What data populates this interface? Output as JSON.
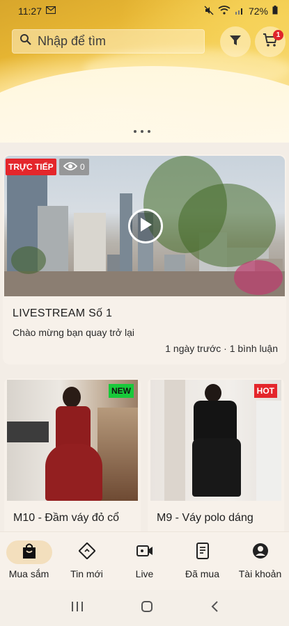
{
  "status_bar": {
    "time": "11:27",
    "battery": "72%"
  },
  "search": {
    "placeholder": "Nhập để tìm"
  },
  "cart": {
    "badge_count": "1"
  },
  "livestream": {
    "live_label": "TRỰC TIẾP",
    "viewers": "0",
    "title": "LIVESTREAM Số 1",
    "subtitle": "Chào mừng bạn quay trở lại",
    "meta": "1 ngày trước · 1 bình luận"
  },
  "products": [
    {
      "name": "M10 - Đầm váy đỏ cổ",
      "badge": "NEW",
      "badge_color": "#18c93a"
    },
    {
      "name": "M9 - Váy polo dáng",
      "badge": "HOT",
      "badge_color": "#e4262b"
    }
  ],
  "bottom_nav": [
    {
      "label": "Mua sắm",
      "icon": "shopping-bag-icon",
      "active": true
    },
    {
      "label": "Tin mới",
      "icon": "news-tag-icon",
      "active": false
    },
    {
      "label": "Live",
      "icon": "video-camera-icon",
      "active": false
    },
    {
      "label": "Đã mua",
      "icon": "receipt-icon",
      "active": false
    },
    {
      "label": "Tài khoản",
      "icon": "account-icon",
      "active": false
    }
  ],
  "colors": {
    "accent": "#f3dfbd",
    "live_red": "#e4262b",
    "new_green": "#18c93a"
  }
}
